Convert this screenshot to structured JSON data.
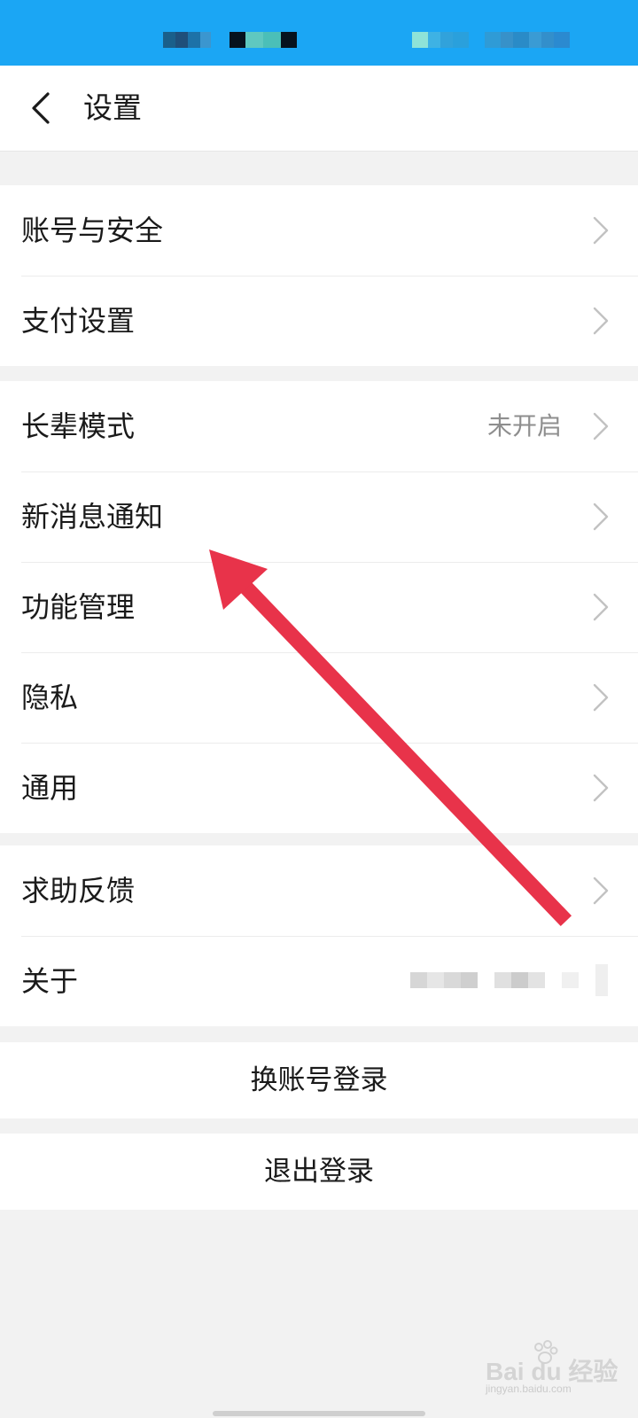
{
  "status_bar": {
    "color": "#1ba6f4"
  },
  "header": {
    "back_icon": "chevron-left-icon",
    "title": "设置"
  },
  "groups": [
    {
      "items": [
        {
          "label": "账号与安全",
          "value": ""
        },
        {
          "label": "支付设置",
          "value": ""
        }
      ]
    },
    {
      "items": [
        {
          "label": "长辈模式",
          "value": "未开启"
        },
        {
          "label": "新消息通知",
          "value": ""
        },
        {
          "label": "功能管理",
          "value": ""
        },
        {
          "label": "隐私",
          "value": ""
        },
        {
          "label": "通用",
          "value": ""
        }
      ]
    },
    {
      "items": [
        {
          "label": "求助反馈",
          "value": ""
        },
        {
          "label": "关于",
          "value": ""
        }
      ]
    }
  ],
  "actions": {
    "switch_account": "换账号登录",
    "logout": "退出登录"
  },
  "annotation": {
    "arrow_color": "#e8334a",
    "target": "新消息通知"
  },
  "watermark": {
    "brand": "Bai du 经验",
    "sub": "jingyan.baidu.com"
  }
}
